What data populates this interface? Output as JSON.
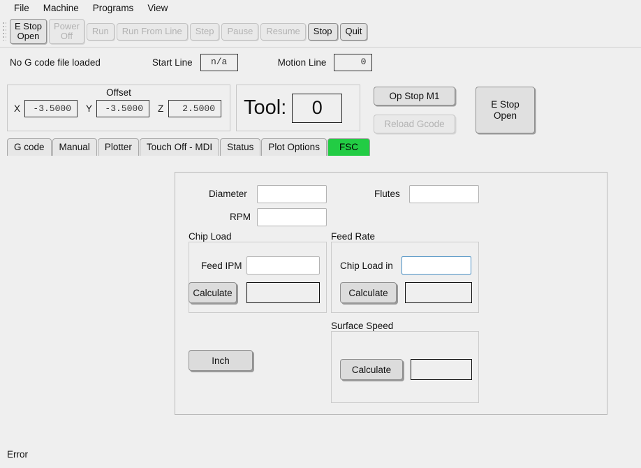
{
  "menubar": {
    "items": [
      {
        "label": "File"
      },
      {
        "label": "Machine"
      },
      {
        "label": "Programs"
      },
      {
        "label": "View"
      }
    ]
  },
  "toolbar": {
    "buttons": [
      {
        "label": "E Stop\nOpen",
        "enabled": true
      },
      {
        "label": "Power\nOff",
        "enabled": false
      },
      {
        "label": "Run",
        "enabled": false
      },
      {
        "label": "Run From Line",
        "enabled": false
      },
      {
        "label": "Step",
        "enabled": false
      },
      {
        "label": "Pause",
        "enabled": false
      },
      {
        "label": "Resume",
        "enabled": false
      },
      {
        "label": "Stop",
        "enabled": true
      },
      {
        "label": "Quit",
        "enabled": true
      }
    ]
  },
  "filerow": {
    "file_status": "No G code file loaded",
    "start_line_label": "Start Line",
    "start_line_value": "n/a",
    "motion_line_label": "Motion Line",
    "motion_line_value": "0"
  },
  "offset": {
    "title": "Offset",
    "x_label": "X",
    "x_value": "-3.5000",
    "y_label": "Y",
    "y_value": "-3.5000",
    "z_label": "Z",
    "z_value": "2.5000"
  },
  "tool": {
    "label": "Tool:",
    "value": "0"
  },
  "side_buttons": {
    "op_stop": "Op Stop M1",
    "reload_gcode": "Reload Gcode",
    "e_stop": "E Stop\nOpen"
  },
  "tabs": [
    {
      "label": "G code",
      "active": false
    },
    {
      "label": "Manual",
      "active": false
    },
    {
      "label": "Plotter",
      "active": false
    },
    {
      "label": "Touch Off - MDI",
      "active": false
    },
    {
      "label": "Status",
      "active": false
    },
    {
      "label": "Plot Options",
      "active": false
    },
    {
      "label": "FSC",
      "active": true
    }
  ],
  "fsc": {
    "diameter_label": "Diameter",
    "diameter_value": "",
    "flutes_label": "Flutes",
    "flutes_value": "",
    "rpm_label": "RPM",
    "rpm_value": "",
    "chip_load": {
      "title": "Chip Load",
      "feed_ipm_label": "Feed IPM",
      "feed_ipm_value": "",
      "calculate_label": "Calculate",
      "result_value": ""
    },
    "feed_rate": {
      "title": "Feed Rate",
      "chip_load_in_label": "Chip Load in",
      "chip_load_in_value": "",
      "calculate_label": "Calculate",
      "result_value": ""
    },
    "surface_speed": {
      "title": "Surface Speed",
      "calculate_label": "Calculate",
      "result_value": ""
    },
    "units_button": "Inch"
  },
  "statusbar": {
    "error_label": "Error"
  },
  "colors": {
    "active_tab": "#22cc44",
    "window_bg": "#efefef",
    "field_bg": "#ffffff",
    "focus_border": "#4a90c4"
  }
}
